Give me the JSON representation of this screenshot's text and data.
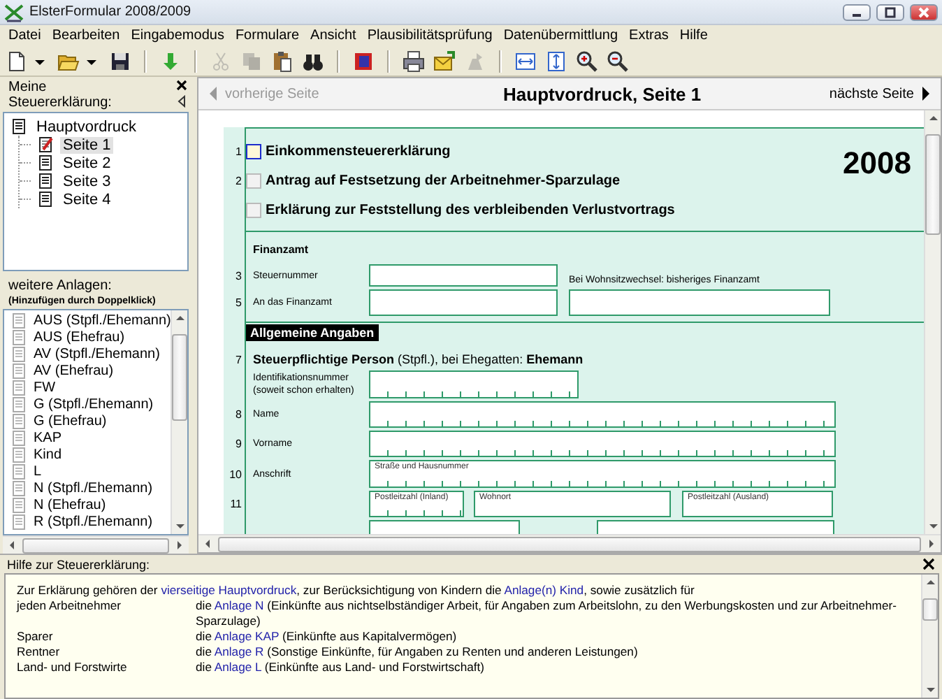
{
  "window": {
    "title": "ElsterFormular 2008/2009"
  },
  "menu": [
    "Datei",
    "Bearbeiten",
    "Eingabemodus",
    "Formulare",
    "Ansicht",
    "Plausibilitätsprüfung",
    "Datenübermittlung",
    "Extras",
    "Hilfe"
  ],
  "toolbar": [
    {
      "kind": "new",
      "disabled": false
    },
    {
      "kind": "dropdown",
      "disabled": false
    },
    {
      "kind": "open",
      "disabled": false
    },
    {
      "kind": "dropdown",
      "disabled": false
    },
    {
      "kind": "save",
      "disabled": false
    },
    {
      "kind": "separator"
    },
    {
      "kind": "check",
      "disabled": false
    },
    {
      "kind": "separator"
    },
    {
      "kind": "cut",
      "disabled": true
    },
    {
      "kind": "copy",
      "disabled": true
    },
    {
      "kind": "paste",
      "disabled": false
    },
    {
      "kind": "find",
      "disabled": false
    },
    {
      "kind": "separator"
    },
    {
      "kind": "book",
      "disabled": false
    },
    {
      "kind": "separator"
    },
    {
      "kind": "print",
      "disabled": false
    },
    {
      "kind": "mail",
      "disabled": false
    },
    {
      "kind": "send",
      "disabled": true
    },
    {
      "kind": "separator"
    },
    {
      "kind": "fit-width",
      "disabled": false
    },
    {
      "kind": "fit-height",
      "disabled": false
    },
    {
      "kind": "zoom-in",
      "disabled": false
    },
    {
      "kind": "zoom-out",
      "disabled": false
    }
  ],
  "sidebar": {
    "title": "Meine Steuererklärung:",
    "tree": [
      {
        "label": "Hauptvordruck",
        "selected": false,
        "children": [
          {
            "label": "Seite 1",
            "selected": true
          },
          {
            "label": "Seite 2",
            "selected": false
          },
          {
            "label": "Seite 3",
            "selected": false
          },
          {
            "label": "Seite 4",
            "selected": false
          }
        ]
      }
    ],
    "anlagen": {
      "heading": "weitere Anlagen:",
      "hint": "(Hinzufügen durch Doppelklick)",
      "items": [
        {
          "label": "AUS (Stpfl./Ehemann)",
          "selected": false
        },
        {
          "label": "AUS (Ehefrau)",
          "selected": false
        },
        {
          "label": "AV (Stpfl./Ehemann)",
          "selected": false
        },
        {
          "label": "AV (Ehefrau)",
          "selected": false
        },
        {
          "label": "FW",
          "selected": false
        },
        {
          "label": "G (Stpfl./Ehemann)",
          "selected": false
        },
        {
          "label": "G (Ehefrau)",
          "selected": false
        },
        {
          "label": "KAP",
          "selected": false
        },
        {
          "label": "Kind",
          "selected": false
        },
        {
          "label": "L",
          "selected": false
        },
        {
          "label": "N (Stpfl./Ehemann)",
          "selected": false
        },
        {
          "label": "N (Ehefrau)",
          "selected": false
        },
        {
          "label": "R (Stpfl./Ehemann)",
          "selected": false
        }
      ]
    }
  },
  "form": {
    "title": "Hauptvordruck, Seite 1",
    "prev": {
      "label": "vorherige Seite",
      "disabled": true
    },
    "next": {
      "label": "nächste Seite",
      "disabled": false
    },
    "year": "2008",
    "checkboxes": [
      {
        "line": "1",
        "label": "Einkommensteuererklärung",
        "checked": false,
        "focused": true
      },
      {
        "line": "2",
        "label": "Antrag auf Festsetzung der Arbeitnehmer-Sparzulage",
        "checked": false,
        "focused": false
      },
      {
        "label": "Erklärung zur Feststellung des verbleibenden Verlustvortrags",
        "checked": false,
        "focused": false
      }
    ],
    "finanzamt": {
      "heading": "Finanzamt",
      "steuernummer": {
        "line": "3",
        "label": "Steuernummer"
      },
      "note": "Bei Wohnsitzwechsel: bisheriges Finanzamt",
      "an_das": {
        "line": "5",
        "label": "An das Finanzamt"
      }
    },
    "general": {
      "banner": "Allgemeine Angaben",
      "person": {
        "line": "7",
        "text": "**Steuerpflichtige Person** (Stpfl.), bei Ehegatten: **Ehemann**"
      },
      "rows": [
        {
          "kind": "id",
          "label": "Identifikationsnummer (soweit schon erhalten)"
        },
        {
          "kind": "full",
          "line": "8",
          "label": "Name"
        },
        {
          "kind": "full",
          "line": "9",
          "label": "Vorname"
        },
        {
          "kind": "full",
          "line": "10",
          "label": "Anschrift",
          "caption": "Straße und Hausnummer"
        },
        {
          "kind": "city",
          "line": "11",
          "captions": [
            "Postleitzahl (Inland)",
            "Wohnort",
            "Postleitzahl (Ausland)"
          ]
        },
        {
          "kind": "cut"
        }
      ]
    }
  },
  "help": {
    "title": "Hilfe zur Steuererklärung:",
    "intro": [
      {
        "kind": "text",
        "text": "Zur Erklärung gehören der"
      },
      {
        "kind": "link",
        "text": "vierseitige Hauptvordruck"
      },
      {
        "kind": "text",
        "text": ", zur Berücksichtigung von Kindern die"
      },
      {
        "kind": "link",
        "text": "Anlage(n) Kind"
      },
      {
        "kind": "text",
        "text": ", sowie zusätzlich für"
      }
    ],
    "rows": [
      {
        "label": "jeden Arbeitnehmer",
        "lead": "die",
        "link": "Anlage N",
        "rest": "(Einkünfte aus nichtselbständiger Arbeit, für Angaben zum Arbeitslohn, zu den Werbungskosten und zur Arbeitnehmer-Sparzulage)"
      },
      {
        "label": "Sparer",
        "lead": "die",
        "link": "Anlage KAP",
        "rest": "(Einkünfte aus Kapitalvermögen)"
      },
      {
        "label": "Rentner",
        "lead": "die",
        "link": "Anlage R",
        "rest": "(Sonstige Einkünfte, für Angaben zu Renten und anderen Leistungen)"
      },
      {
        "label": "Land- und Forstwirte",
        "lead": "die",
        "link": "Anlage L",
        "rest": "(Einkünfte aus Land- und Forstwirtschaft)"
      }
    ]
  }
}
